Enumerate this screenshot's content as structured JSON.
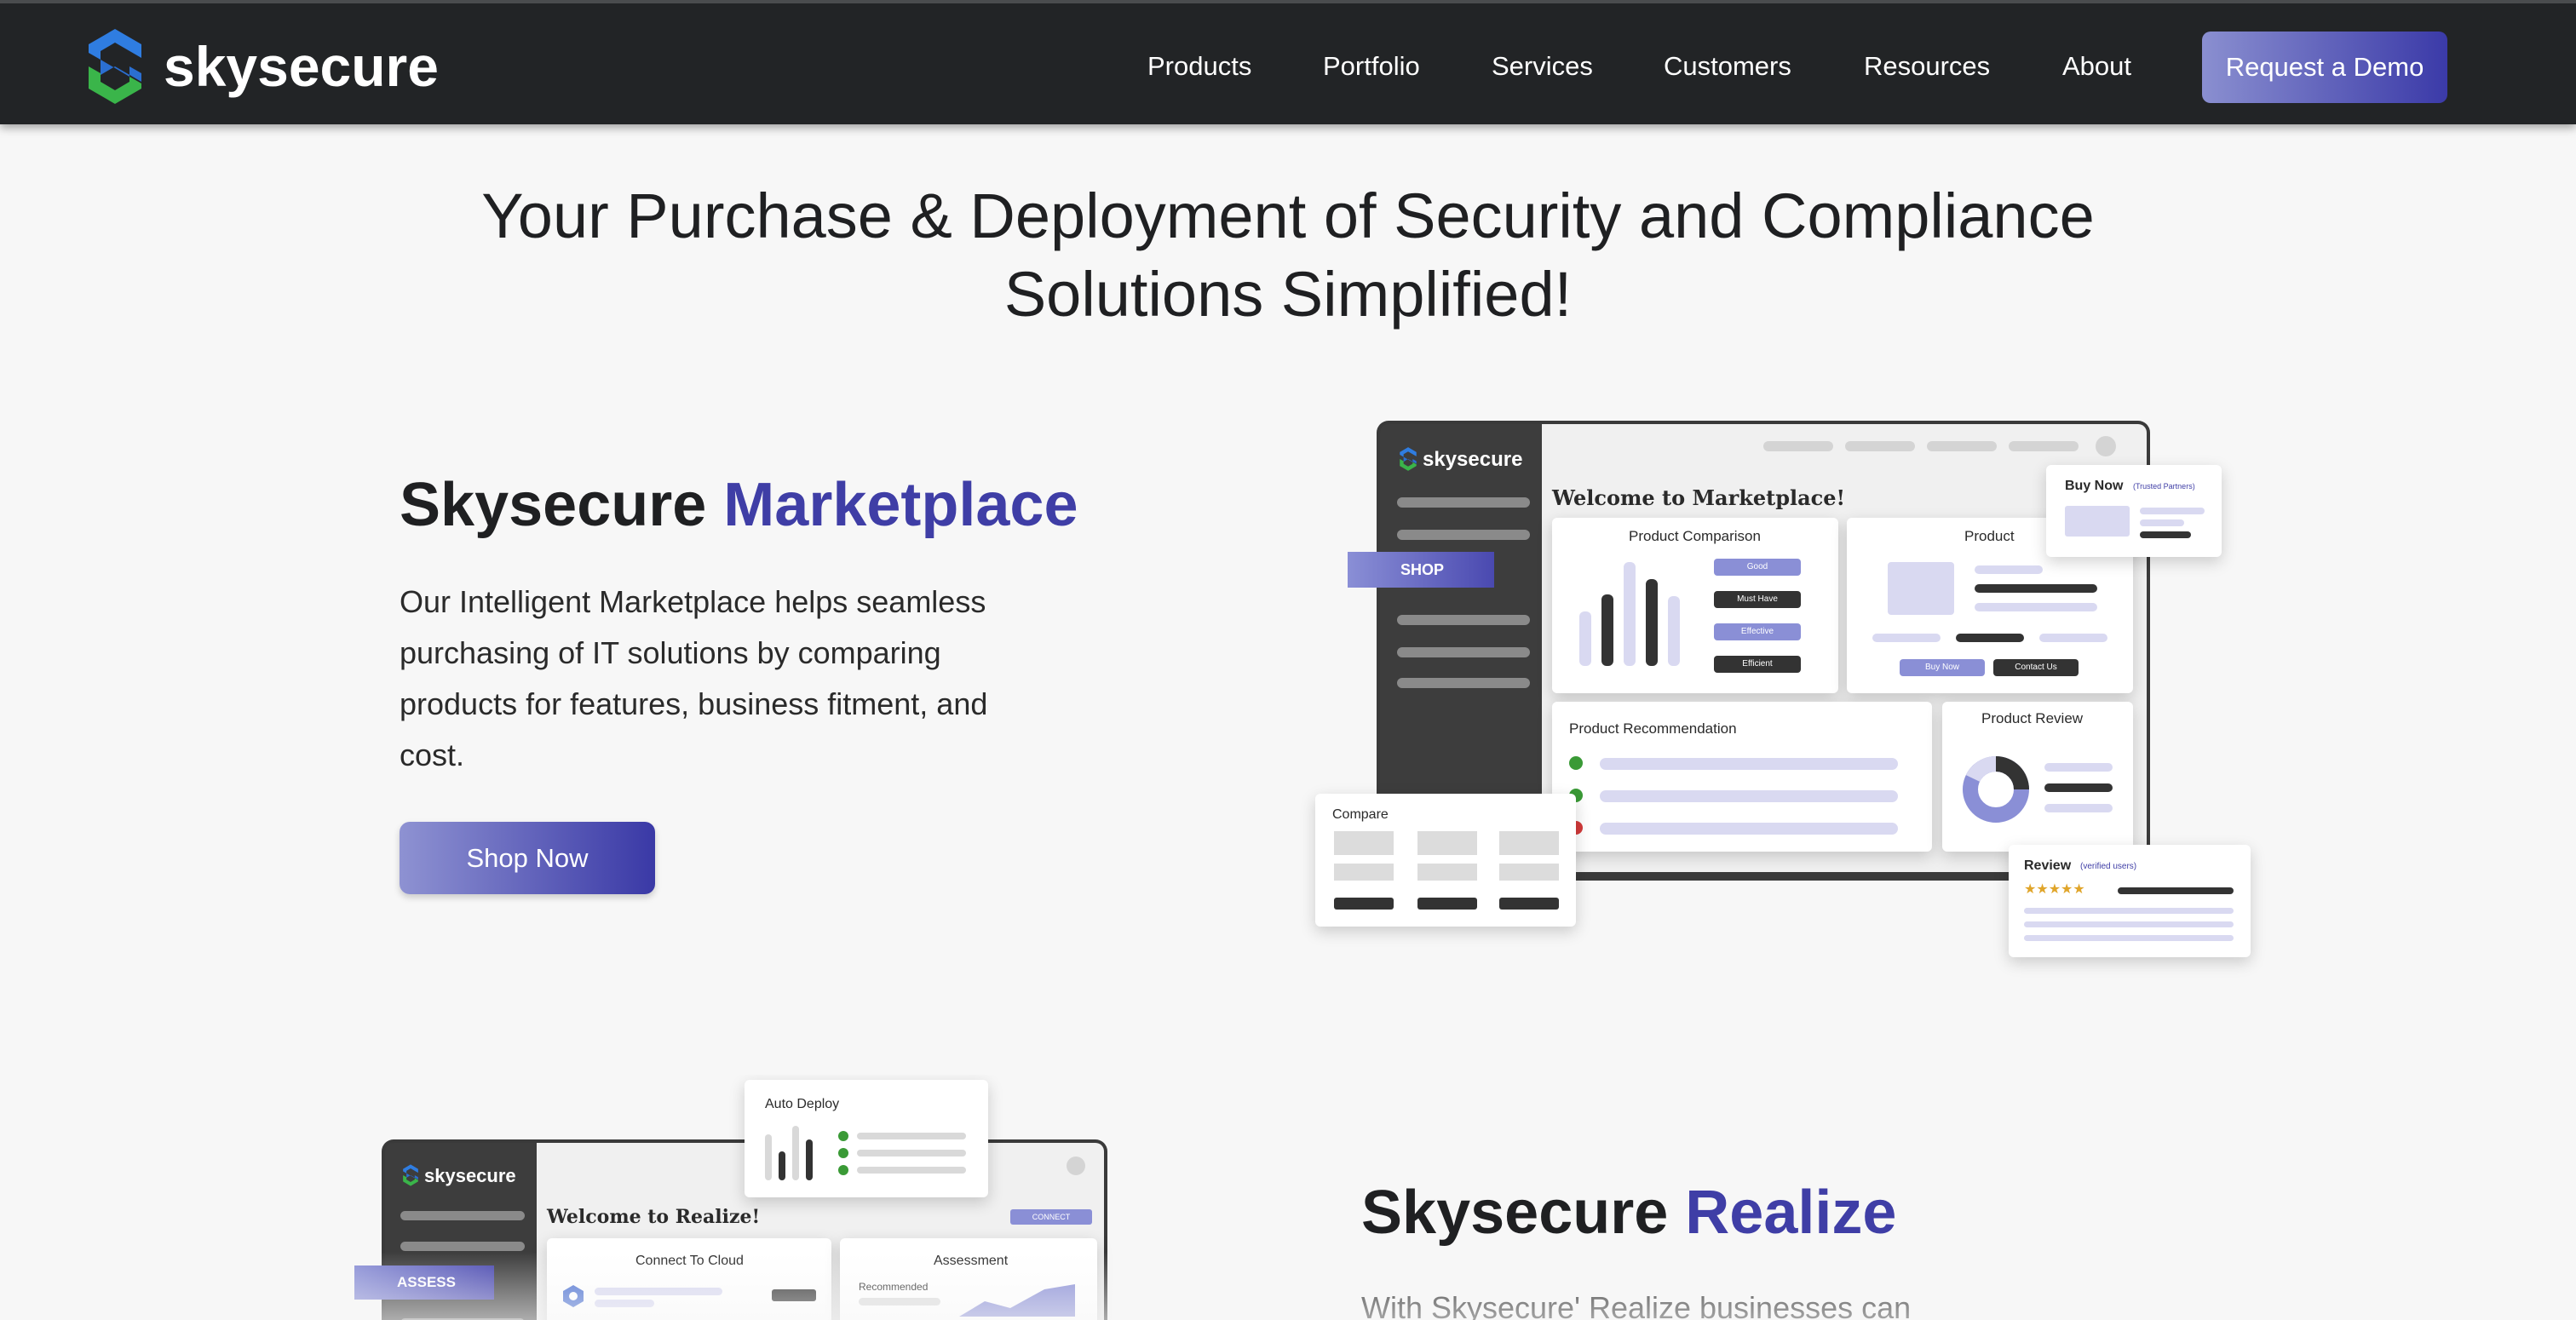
{
  "brand": {
    "name": "skysecure"
  },
  "nav": {
    "items": [
      "Products",
      "Portfolio",
      "Services",
      "Customers",
      "Resources",
      "About"
    ],
    "cta": "Request a Demo"
  },
  "hero": {
    "title_line1": "Your Purchase & Deployment of Security and Compliance",
    "title_line2": "Solutions Simplified!"
  },
  "marketplace": {
    "title_plain": "Skysecure",
    "title_accent": "Marketplace",
    "description_lines": [
      "Our Intelligent Marketplace helps seamless",
      "purchasing of IT solutions by comparing",
      "products for features, business fitment, and",
      "cost."
    ],
    "button": "Shop Now",
    "mockup": {
      "brand": "skysecure",
      "welcome": "Welcome to Marketplace!",
      "tag": "SHOP",
      "product_comparison": "Product Comparison",
      "comparison_tags": [
        "Good",
        "Must Have",
        "Effective",
        "Efficient"
      ],
      "product": "Product",
      "product_buttons": [
        "Buy Now",
        "Contact Us"
      ],
      "product_recommendation": "Product Recommendation",
      "product_review": "Product Review",
      "buy_now": "Buy Now",
      "buy_now_sub": "(Trusted Partners)",
      "compare": "Compare",
      "review": "Review",
      "review_sub": "(verified users)"
    }
  },
  "realize": {
    "title_plain": "Skysecure",
    "title_accent": "Realize",
    "description_partial": "With Skysecure' Realize businesses can",
    "mockup": {
      "brand": "skysecure",
      "welcome": "Welcome to Realize!",
      "tag": "ASSESS",
      "connect_button": "CONNECT",
      "auto_deploy": "Auto Deploy",
      "connect_to_cloud": "Connect To Cloud",
      "assessment": "Assessment",
      "recommended": "Recommended"
    }
  },
  "colors": {
    "accent": "#3f3ea6",
    "nav_bg": "#222426",
    "logo_blue": "#2f7de1",
    "logo_green": "#3ab54a",
    "dark_panel": "#3d3d3d",
    "lavender": "#d9d9f1"
  }
}
